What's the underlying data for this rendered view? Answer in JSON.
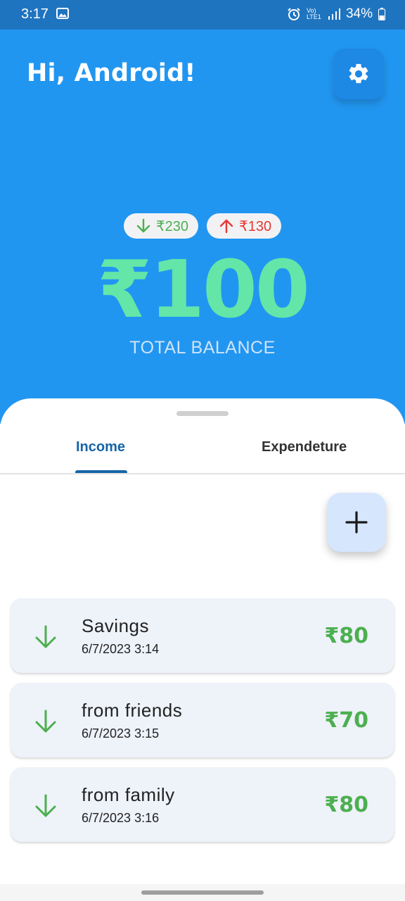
{
  "status_bar": {
    "time": "3:17",
    "network": "Vo) LTE1",
    "battery": "34%",
    "icons": [
      "image-icon",
      "alarm-icon",
      "volte-icon",
      "signal-icon",
      "battery-icon"
    ]
  },
  "header": {
    "greeting": "Hi, Android!",
    "settings_icon": "gear-icon"
  },
  "summary": {
    "income_chip": "₹230",
    "expense_chip": "₹130",
    "balance": "₹100",
    "balance_label": "TOTAL BALANCE"
  },
  "tabs": {
    "items": [
      {
        "label": "Income",
        "active": true
      },
      {
        "label": "Expendeture",
        "active": false
      }
    ]
  },
  "fab": {
    "icon": "plus-icon"
  },
  "transactions": [
    {
      "title": "Savings",
      "date": "6/7/2023 3:14",
      "amount": "₹80",
      "type": "income"
    },
    {
      "title": "from friends",
      "date": "6/7/2023 3:15",
      "amount": "₹70",
      "type": "income"
    },
    {
      "title": "from family",
      "date": "6/7/2023 3:16",
      "amount": "₹80",
      "type": "income"
    }
  ],
  "colors": {
    "hero": "#2196f0",
    "status_bar": "#1f74c0",
    "balance": "#63e6a8",
    "income": "#4caf50",
    "expense": "#e53935",
    "tab_active": "#1565a8",
    "fab": "#d5e6fd",
    "card": "#eef2f9"
  }
}
